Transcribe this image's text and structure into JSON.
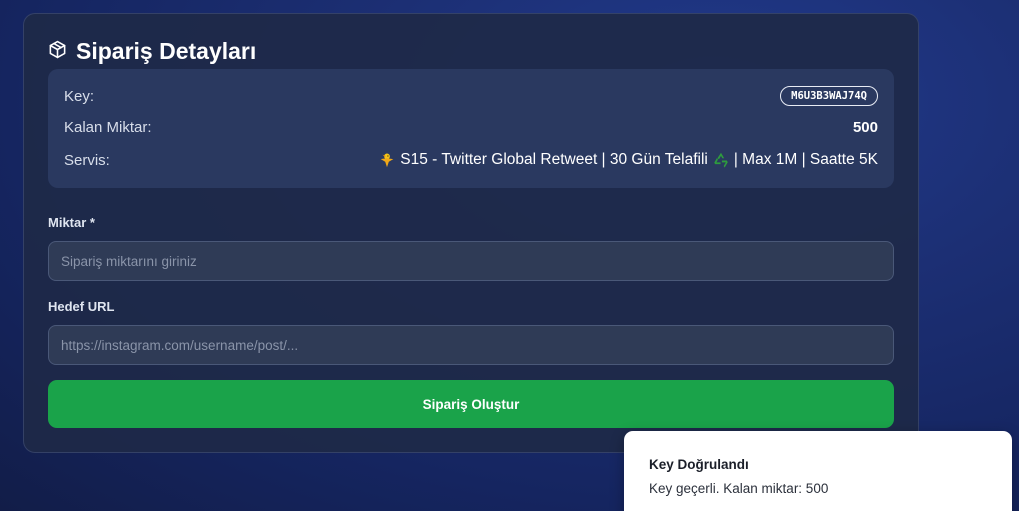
{
  "order": {
    "title": "Sipariş Detayları",
    "title_icon": "package-icon",
    "details": {
      "key_label": "Key:",
      "key_value": "M6U3B3WAJ74Q",
      "remaining_label": "Kalan Miktar:",
      "remaining_value": "500",
      "service_label": "Servis:",
      "service_part1": "S15 - Twitter Global Retweet | 30 Gün Telafili",
      "service_part2": "| Max 1M | Saatte 5K",
      "service_icons": [
        "bird-emoji-icon",
        "recycle-emoji-icon"
      ]
    },
    "quantity_label": "Miktar *",
    "quantity_placeholder": "Sipariş miktarını giriniz",
    "url_label": "Hedef URL",
    "url_placeholder": "https://instagram.com/username/post/...",
    "submit_label": "Sipariş Oluştur"
  },
  "toast": {
    "title": "Key Doğrulandı",
    "description": "Key geçerli. Kalan miktar: 500"
  },
  "colors": {
    "accent_green": "#1aa34a",
    "card_bg": "#1e2948",
    "details_bg": "#2a3960"
  }
}
